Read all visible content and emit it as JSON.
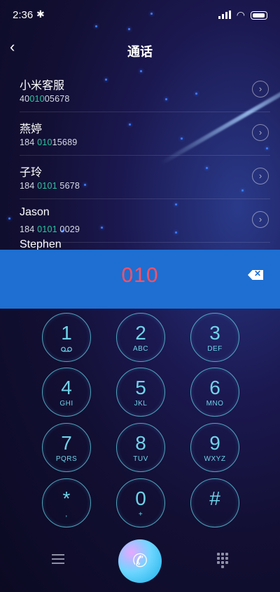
{
  "status": {
    "time": "2:36"
  },
  "header": {
    "title": "通话"
  },
  "contacts": [
    {
      "name": "小米客服",
      "num_pre": "40",
      "num_hl": "010",
      "num_post": "05678"
    },
    {
      "name": "燕婷",
      "num_pre": "184 ",
      "num_hl": "010",
      "num_post": "15689"
    },
    {
      "name": "子玲",
      "num_pre": "184 ",
      "num_hl": "0101",
      "num_post": " 5678"
    },
    {
      "name": "Jason",
      "num_pre": "184 ",
      "num_hl": "0101",
      "num_post": " 0029"
    },
    {
      "name": "Stephen",
      "num_pre": "",
      "num_hl": "",
      "num_post": ""
    }
  ],
  "dialer": {
    "input": "010"
  },
  "keys": [
    {
      "digit": "1",
      "sub": "voicemail-icon"
    },
    {
      "digit": "2",
      "sub": "ABC"
    },
    {
      "digit": "3",
      "sub": "DEF"
    },
    {
      "digit": "4",
      "sub": "GHI"
    },
    {
      "digit": "5",
      "sub": "JKL"
    },
    {
      "digit": "6",
      "sub": "MNO"
    },
    {
      "digit": "7",
      "sub": "PQRS"
    },
    {
      "digit": "8",
      "sub": "TUV"
    },
    {
      "digit": "9",
      "sub": "WXYZ"
    },
    {
      "digit": "*",
      "sub": ","
    },
    {
      "digit": "0",
      "sub": "+"
    },
    {
      "digit": "#",
      "sub": ""
    }
  ],
  "colors": {
    "accent": "#1e6fd1",
    "match": "#2dc7a0",
    "dialed": "#ff4f62",
    "key": "#6fd3e8"
  }
}
